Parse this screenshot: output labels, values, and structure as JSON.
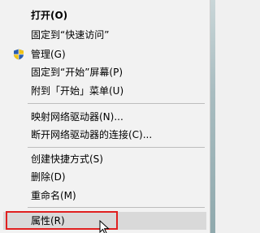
{
  "context_menu": {
    "items": {
      "open": "打开(O)",
      "pin_quick_access": "固定到“快速访问”",
      "manage": "管理(G)",
      "pin_start_screen": "固定到“开始”屏幕(P)",
      "pin_start_menu": "附到「开始」菜单(U)",
      "map_network_drive": "映射网络驱动器(N)...",
      "disconnect_network_drive": "断开网络驱动器的连接(C)...",
      "create_shortcut": "创建快捷方式(S)",
      "delete": "删除(D)",
      "rename": "重命名(M)",
      "properties": "属性(R)"
    },
    "highlighted_item": "properties",
    "highlight_color": "#e02020",
    "icons": {
      "manage": "uac-shield-icon"
    }
  }
}
